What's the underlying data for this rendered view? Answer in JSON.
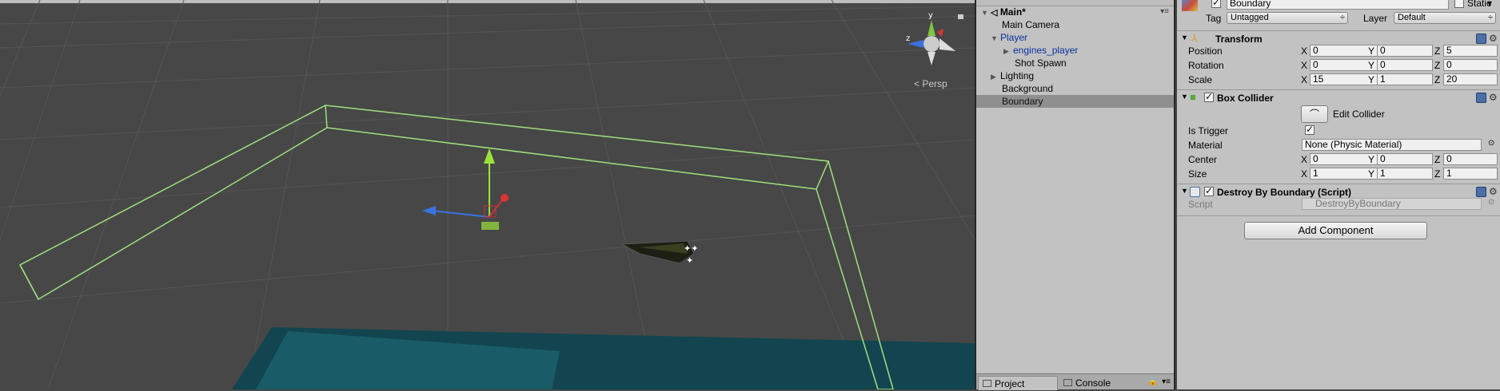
{
  "scene": {
    "persp_label": "Persp",
    "gizmo_y": "y",
    "gizmo_z": "z"
  },
  "hierarchy": {
    "scene_name": "Main*",
    "items": [
      {
        "label": "Main Camera"
      },
      {
        "label": "Player"
      },
      {
        "label": "engines_player"
      },
      {
        "label": "Shot Spawn"
      },
      {
        "label": "Lighting"
      },
      {
        "label": "Background"
      },
      {
        "label": "Boundary"
      }
    ],
    "tabs": [
      {
        "label": "Project"
      },
      {
        "label": "Console"
      }
    ]
  },
  "inspector": {
    "object_name": "Boundary",
    "static_label": "Static",
    "tag_label": "Tag",
    "tag_value": "Untagged",
    "layer_label": "Layer",
    "layer_value": "Default",
    "transform": {
      "title": "Transform",
      "position_label": "Position",
      "position": {
        "x": "0",
        "y": "0",
        "z": "5"
      },
      "rotation_label": "Rotation",
      "rotation": {
        "x": "0",
        "y": "0",
        "z": "0"
      },
      "scale_label": "Scale",
      "scale": {
        "x": "15",
        "y": "1",
        "z": "20"
      }
    },
    "axes": {
      "x": "X",
      "y": "Y",
      "z": "Z"
    },
    "box_collider": {
      "title": "Box Collider",
      "edit_label": "Edit Collider",
      "is_trigger_label": "Is Trigger",
      "material_label": "Material",
      "material_value": "None (Physic Material)",
      "center_label": "Center",
      "center": {
        "x": "0",
        "y": "0",
        "z": "0"
      },
      "size_label": "Size",
      "size": {
        "x": "1",
        "y": "1",
        "z": "1"
      }
    },
    "script_comp": {
      "title": "Destroy By Boundary (Script)",
      "script_label": "Script",
      "script_value": "DestroyByBoundary"
    },
    "add_component_label": "Add Component"
  }
}
